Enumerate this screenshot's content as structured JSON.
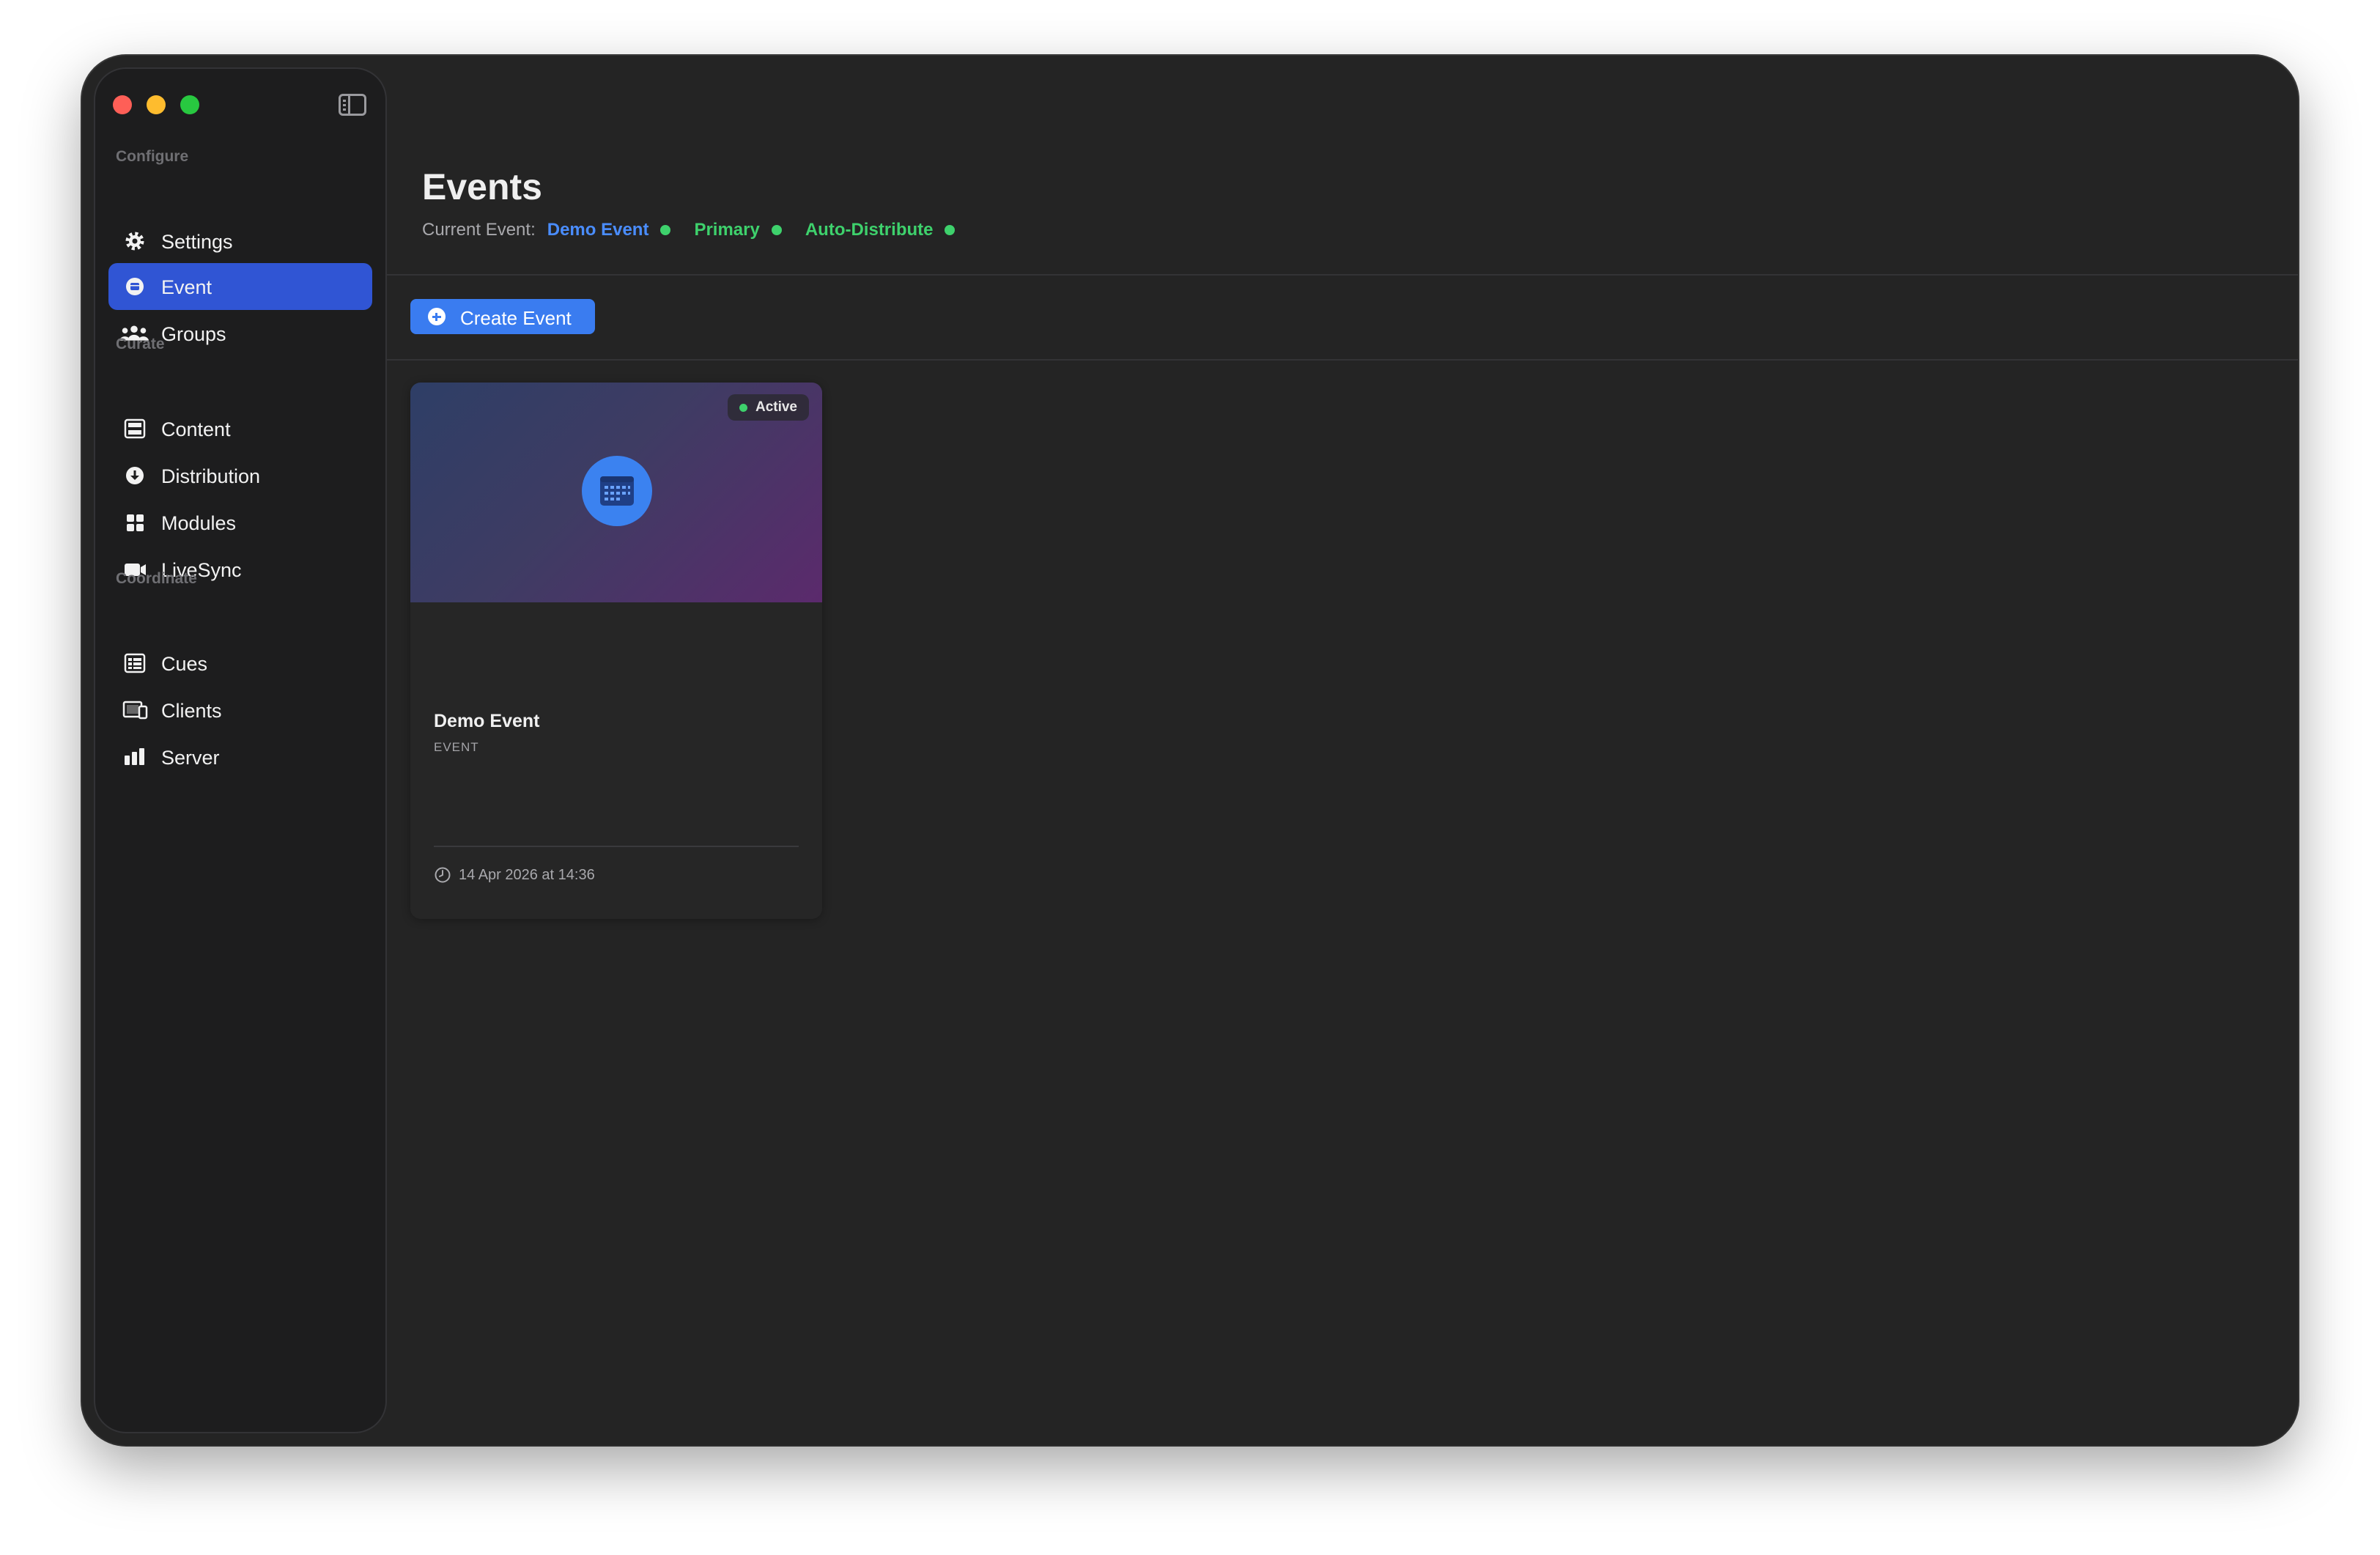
{
  "sidebar": {
    "sections": [
      {
        "label": "Configure"
      },
      {
        "label": "Curate"
      },
      {
        "label": "Coordinate"
      }
    ],
    "items": [
      {
        "label": "Settings",
        "icon": "gear-icon"
      },
      {
        "label": "Event",
        "icon": "event-icon",
        "active": true
      },
      {
        "label": "Groups",
        "icon": "people-icon"
      },
      {
        "label": "Content",
        "icon": "film-icon"
      },
      {
        "label": "Distribution",
        "icon": "download-circle-icon"
      },
      {
        "label": "Modules",
        "icon": "grid-icon"
      },
      {
        "label": "LiveSync",
        "icon": "video-camera-icon"
      },
      {
        "label": "Cues",
        "icon": "list-icon"
      },
      {
        "label": "Clients",
        "icon": "display-icon"
      },
      {
        "label": "Server",
        "icon": "bar-chart-icon"
      }
    ]
  },
  "header": {
    "title": "Events",
    "current_event_label": "Current Event:",
    "current_event_name": "Demo Event",
    "status_primary": "Primary",
    "status_auto": "Auto-Distribute"
  },
  "toolbar": {
    "create_label": "Create Event"
  },
  "events": [
    {
      "name": "Demo Event",
      "type": "EVENT",
      "status": "Active",
      "date": "14 Apr 2026 at 14:36"
    }
  ],
  "colors": {
    "accent": "#3a7cf0",
    "active_nav": "#3055d4",
    "status_green": "#3ed16c",
    "link_blue": "#4a8dff"
  }
}
